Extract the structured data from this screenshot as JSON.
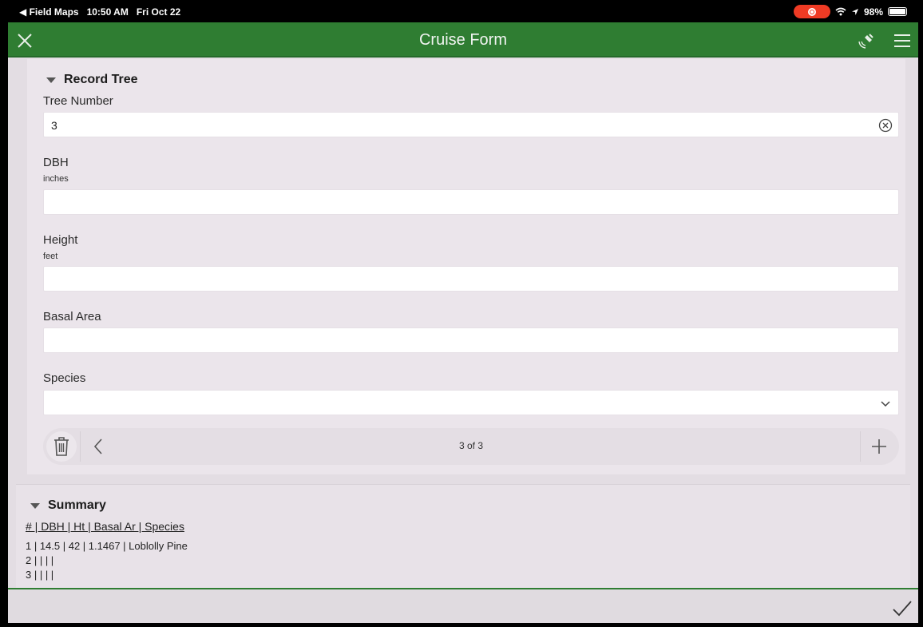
{
  "status": {
    "back_app": "◀ Field Maps",
    "time": "10:50 AM",
    "date": "Fri Oct 22",
    "battery": "98%"
  },
  "header": {
    "title": "Cruise Form"
  },
  "record": {
    "section_title": "Record Tree",
    "fields": {
      "tree_number": {
        "label": "Tree Number",
        "value": "3"
      },
      "dbh": {
        "label": "DBH",
        "hint": "inches",
        "value": ""
      },
      "height": {
        "label": "Height",
        "hint": "feet",
        "value": ""
      },
      "basal_area": {
        "label": "Basal Area",
        "value": ""
      },
      "species": {
        "label": "Species",
        "value": ""
      }
    },
    "pager": {
      "count": "3 of 3"
    }
  },
  "summary": {
    "section_title": "Summary",
    "header": "# | DBH | Ht | Basal Ar | Species",
    "rows": [
      "1 | 14.5 | 42 | 1.1467 | Loblolly Pine",
      "2 | | | |",
      "3 | | | |"
    ]
  },
  "colors": {
    "header_green": "#2f7d32",
    "record_red": "#ef3b24"
  }
}
